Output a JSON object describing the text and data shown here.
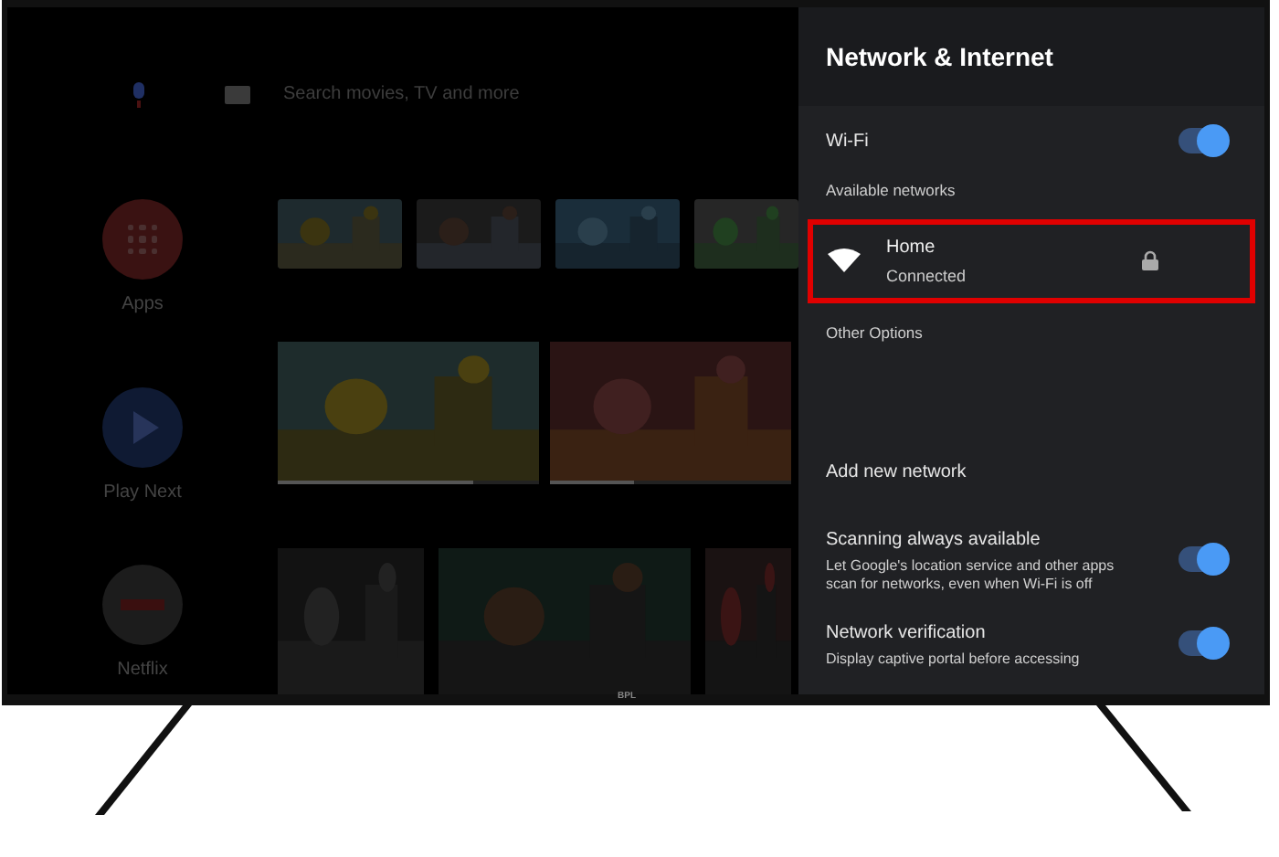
{
  "home": {
    "search": {
      "placeholder": "Search movies, TV and more"
    },
    "nav": [
      {
        "label": "Apps",
        "kind": "apps"
      },
      {
        "label": "Play Next",
        "kind": "play"
      },
      {
        "label": "Netflix",
        "kind": "netflix"
      }
    ],
    "continue_cards": [
      {
        "level": 0.75
      },
      {
        "level": 0.35
      }
    ]
  },
  "panel": {
    "title": "Network & Internet",
    "wifi": {
      "label": "Wi-Fi",
      "on": true
    },
    "available_heading": "Available networks",
    "networks": [
      {
        "name": "Home",
        "status": "Connected",
        "secured": true,
        "highlighted": true
      }
    ],
    "other_heading": "Other Options",
    "options": [
      {
        "kind": "action",
        "label": "Add new network"
      },
      {
        "kind": "toggle",
        "label": "Scanning always available",
        "description": "Let Google's location service and other apps scan for networks, even when Wi-Fi is off",
        "on": true
      },
      {
        "kind": "toggle",
        "label": "Network verification",
        "description": "Display captive portal before accessing",
        "on": true
      }
    ]
  },
  "brand": "BPL"
}
